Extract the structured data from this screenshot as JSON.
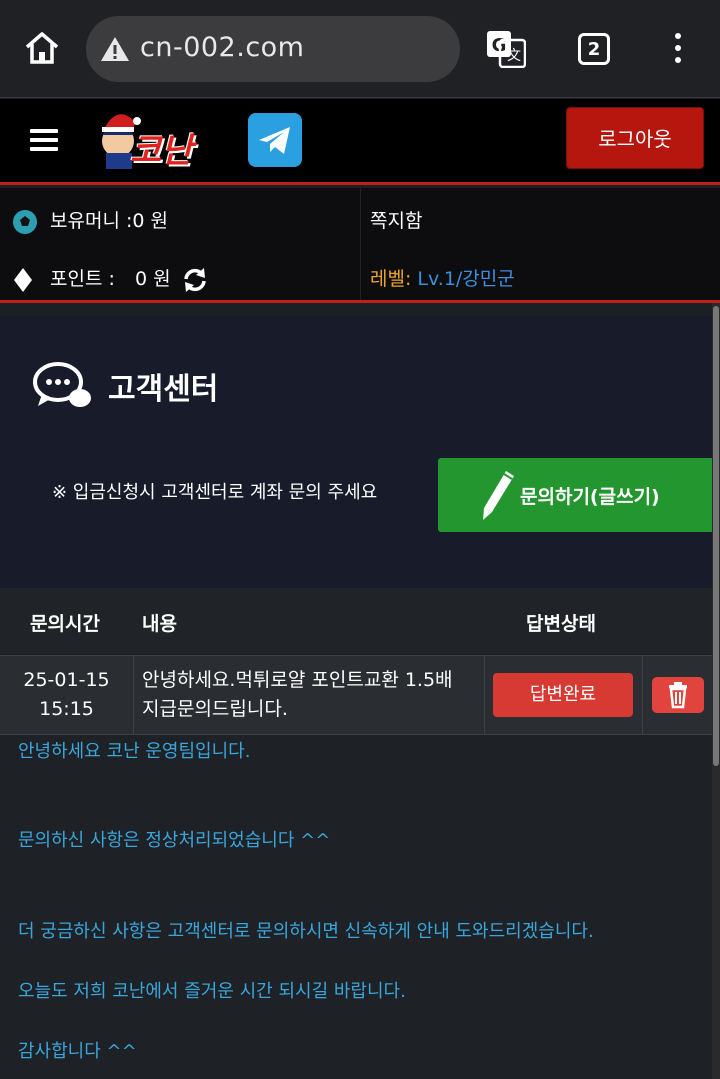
{
  "browser": {
    "url": "cn-002.com",
    "tab_count": "2"
  },
  "header": {
    "logo_text": "코난",
    "logout_label": "로그아웃"
  },
  "info": {
    "money_label": "보유머니 :0 원",
    "point_label": "포인트 :",
    "point_value": "0 원",
    "messages_label": "쪽지함",
    "level_label": "레벨:",
    "level_value": "Lv.1/강민군"
  },
  "support": {
    "title": "고객센터",
    "notice": "※ 입금신청시 고객센터로 계좌 문의 주세요",
    "write_button_label": "문의하기(글쓰기)"
  },
  "table": {
    "headers": [
      "문의시간",
      "내용",
      "답변상태"
    ],
    "rows": [
      {
        "date": "25-01-15",
        "time": "15:15",
        "content_line1": "안녕하세요.먹튀로얄 포인트교환 1.5배",
        "content_line2": "지급문의드립니다.",
        "status": "답변완료"
      }
    ]
  },
  "reply": {
    "lines": [
      "안녕하세요 코난 운영팀입니다.",
      "문의하신 사항은 정상처리되었습니다 ^^",
      "더 궁금하신 사항은 고객센터로 문의하시면 신속하게 안내 도와드리겠습니다.",
      "오늘도 저희 코난에서 즐거운 시간 되시길 바랍니다.",
      "감사합니다 ^^"
    ]
  },
  "colors": {
    "accent_red": "#c0201a",
    "button_green": "#24962f",
    "reply_text": "#39a6dc",
    "level_label": "#f0a528"
  }
}
